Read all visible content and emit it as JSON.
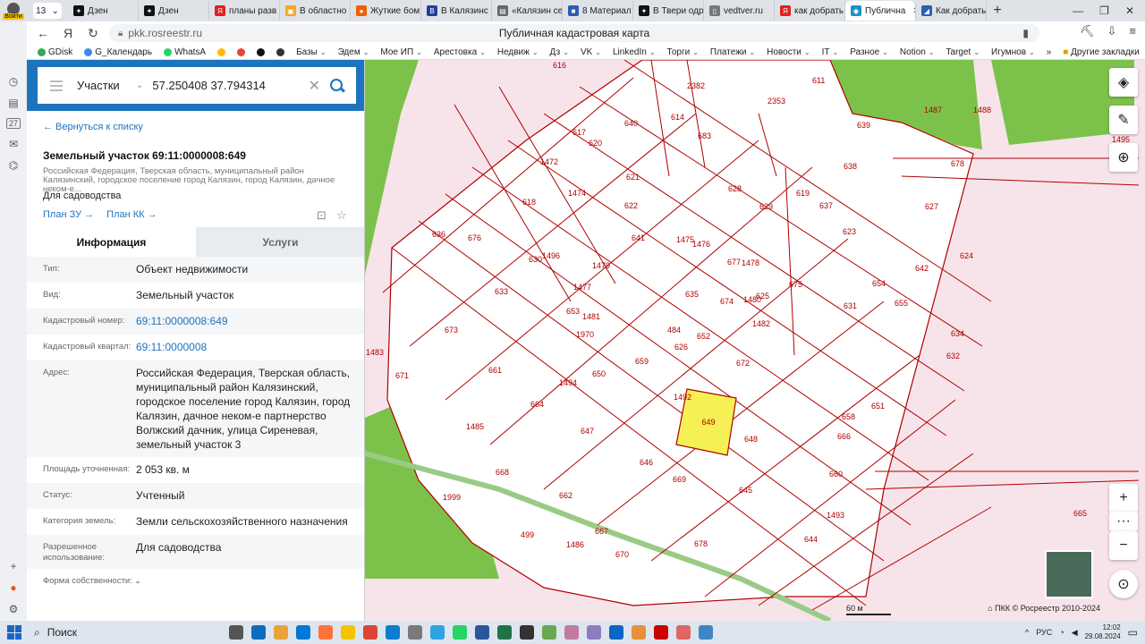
{
  "browser": {
    "profile_label": "Войти",
    "tab_count": "13",
    "tabs": [
      {
        "label": "Дзен",
        "color": "#111111",
        "glyph": "✦"
      },
      {
        "label": "Дзен",
        "color": "#111111",
        "glyph": "✦"
      },
      {
        "label": "планы разв",
        "color": "#e02020",
        "glyph": "Я"
      },
      {
        "label": "В областно",
        "color": "#f5a623",
        "glyph": "▣"
      },
      {
        "label": "Жуткие бом",
        "color": "#f06000",
        "glyph": "●"
      },
      {
        "label": "В Калязинс",
        "color": "#2040a0",
        "glyph": "В"
      },
      {
        "label": "«Калязин се",
        "color": "#666666",
        "glyph": "▤"
      },
      {
        "label": "8 Материал",
        "color": "#2b5db5",
        "glyph": "■"
      },
      {
        "label": "В Твери одр",
        "color": "#111111",
        "glyph": "✦"
      },
      {
        "label": "vedtver.ru",
        "color": "#777777",
        "glyph": "▯"
      },
      {
        "label": "как добрать",
        "color": "#e02020",
        "glyph": "Я"
      },
      {
        "label": "Публична",
        "color": "#1e90c8",
        "glyph": "◆",
        "active": true
      },
      {
        "label": "Как добрать",
        "color": "#2b5db5",
        "glyph": "◢"
      }
    ],
    "url_host": "pkk.rosreestr.ru",
    "page_title": "Публичная кадастровая карта",
    "bookmarks": [
      {
        "label": "GDisk",
        "color": "#34a853",
        "dropdown": false
      },
      {
        "label": "G_Календарь",
        "color": "#4285f4",
        "dropdown": false
      },
      {
        "label": "WhatsA",
        "color": "#25d366",
        "dropdown": false
      },
      {
        "label": "",
        "color": "#fbbc04",
        "dropdown": false
      },
      {
        "label": "",
        "color": "#ea4335",
        "dropdown": false
      },
      {
        "label": "",
        "color": "#111111",
        "dropdown": false
      },
      {
        "label": "",
        "color": "#333333",
        "dropdown": false
      },
      {
        "label": "Базы",
        "color": "",
        "dropdown": true
      },
      {
        "label": "Эдем",
        "color": "",
        "dropdown": true
      },
      {
        "label": "Мое ИП",
        "color": "",
        "dropdown": true
      },
      {
        "label": "Арестовка",
        "color": "",
        "dropdown": true
      },
      {
        "label": "Недвиж",
        "color": "",
        "dropdown": true
      },
      {
        "label": "Дз",
        "color": "",
        "dropdown": true
      },
      {
        "label": "VK",
        "color": "",
        "dropdown": true
      },
      {
        "label": "LinkedIn",
        "color": "",
        "dropdown": true
      },
      {
        "label": "Торги",
        "color": "",
        "dropdown": true
      },
      {
        "label": "Платежи",
        "color": "",
        "dropdown": true
      },
      {
        "label": "Новости",
        "color": "",
        "dropdown": true
      },
      {
        "label": "IT",
        "color": "",
        "dropdown": true
      },
      {
        "label": "Разное",
        "color": "",
        "dropdown": true
      },
      {
        "label": "Notion",
        "color": "",
        "dropdown": true
      },
      {
        "label": "Target",
        "color": "",
        "dropdown": true
      },
      {
        "label": "Игумнов",
        "color": "",
        "dropdown": true
      }
    ],
    "other_bookmarks": "Другие закладки",
    "more_bookmarks": "»"
  },
  "rail": {
    "badge_date": "27"
  },
  "search": {
    "type_label": "Участки",
    "query": "57.250408 37.794314"
  },
  "object": {
    "back_label": "← Вернуться к списку",
    "title": "Земельный участок 69:11:0000008:649",
    "address_short": "Российская Федерация, Тверская область, муниципальный район Калязинский, городское поселение город Калязин, город Калязин, дачное неком-е...",
    "use": "Для садоводства",
    "plan_zu": "План ЗУ",
    "plan_kk": "План КК",
    "tab_info": "Информация",
    "tab_services": "Услуги",
    "rows": [
      {
        "key": "Тип:",
        "value": "Объект недвижимости",
        "link": false
      },
      {
        "key": "Вид:",
        "value": "Земельный участок",
        "link": false
      },
      {
        "key": "Кадастровый номер:",
        "value": "69:11:0000008:649",
        "link": true
      },
      {
        "key": "Кадастровый квартал:",
        "value": "69:11:0000008",
        "link": true
      },
      {
        "key": "Адрес:",
        "value": "Российская Федерация, Тверская область, муниципальный район Калязинский, городское поселение город Калязин, город Калязин, дачное неком-е партнерство Волжский дачник, улица Сиреневая, земельный участок 3",
        "link": false
      },
      {
        "key": "Площадь уточненная:",
        "value": "2 053 кв. м",
        "link": false
      },
      {
        "key": "Статус:",
        "value": "Учтенный",
        "link": false
      },
      {
        "key": "Категория земель:",
        "value": "Земли сельскохозяйственного назначения",
        "link": false
      },
      {
        "key": "Разрешенное использование:",
        "value": "Для садоводства",
        "link": false
      },
      {
        "key": "Форма собственности:",
        "value": "-",
        "link": false
      }
    ]
  },
  "map": {
    "scale_label": "60 м",
    "copyright": "ПКК © Росреестр 2010-2024",
    "selected_lot": "649",
    "lots": [
      "616",
      "2382",
      "2353",
      "611",
      "614",
      "683",
      "617",
      "620",
      "640",
      "639",
      "1487",
      "1488",
      "1495",
      "1472",
      "621",
      "628",
      "629",
      "637",
      "638",
      "678",
      "1474",
      "622",
      "677",
      "618",
      "1475",
      "619",
      "623",
      "627",
      "636",
      "676",
      "641",
      "1496",
      "1476",
      "1478",
      "624",
      "630",
      "675",
      "1479",
      "635",
      "642",
      "654",
      "1477",
      "626",
      "674",
      "1480",
      "631",
      "655",
      "653",
      "1481",
      "625",
      "634",
      "673",
      "1970",
      "1482",
      "632",
      "484",
      "652",
      "633",
      "1494",
      "672",
      "1492",
      "659",
      "651",
      "1483",
      "671",
      "661",
      "650",
      "648",
      "658",
      "664",
      "647",
      "666",
      "646",
      "660",
      "1485",
      "668",
      "669",
      "645",
      "1493",
      "1999",
      "662",
      "665",
      "499",
      "1486",
      "667",
      "670",
      "644",
      "678"
    ]
  },
  "taskbar": {
    "search_label": "Поиск",
    "lang": "РУС",
    "time": "12:02",
    "date": "29.08.2024"
  }
}
